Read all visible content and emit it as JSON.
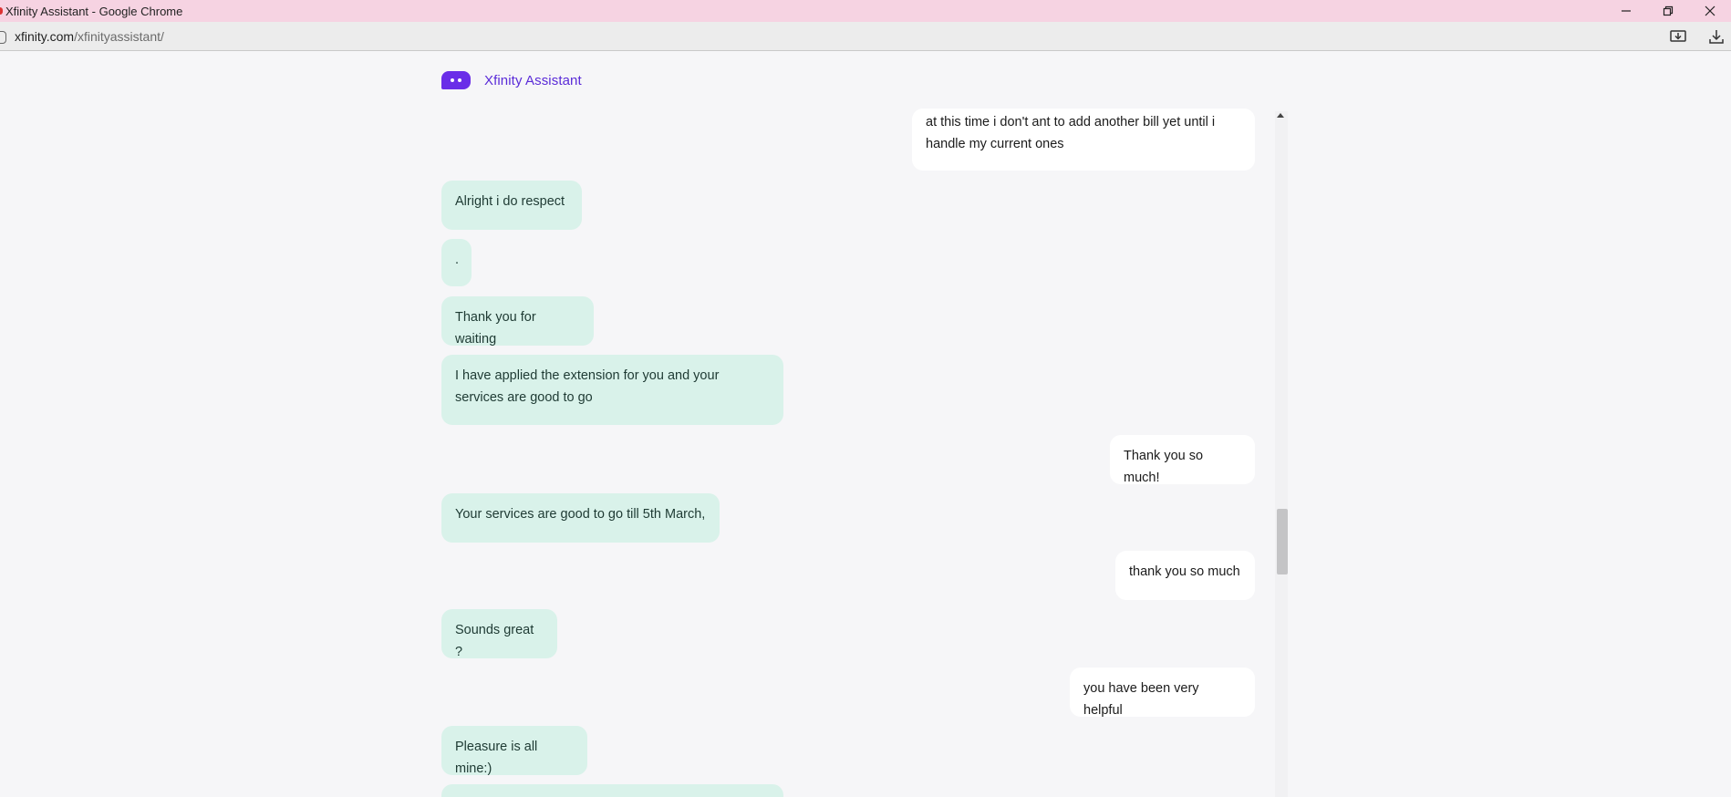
{
  "browser": {
    "window_title": "Xfinity Assistant - Google Chrome",
    "url_host": "xfinity.com",
    "url_path": "/xfinityassistant/"
  },
  "app": {
    "title": "Xfinity Assistant",
    "accent_color": "#6a2ee8"
  },
  "messages": [
    {
      "sender": "user",
      "text": "at this time i don't ant to add another bill yet until i handle my current ones"
    },
    {
      "sender": "agent",
      "text": "Alright i do respect"
    },
    {
      "sender": "agent",
      "text": "."
    },
    {
      "sender": "agent",
      "text": "Thank you for waiting"
    },
    {
      "sender": "agent",
      "text": "I have applied the extension for you and your services are good to go"
    },
    {
      "sender": "user",
      "text": "Thank you so much!"
    },
    {
      "sender": "agent",
      "text": "Your services are good to go till 5th March,"
    },
    {
      "sender": "user",
      "text": "thank you so much"
    },
    {
      "sender": "agent",
      "text": "Sounds great ?"
    },
    {
      "sender": "user",
      "text": "you have been very helpful"
    },
    {
      "sender": "agent",
      "text": "Pleasure is all mine:)"
    },
    {
      "sender": "agent",
      "text": ""
    }
  ],
  "colors": {
    "agent_bubble": "#d9f2ea",
    "user_bubble": "#ffffff",
    "title_bar": "#f6d3e2"
  }
}
